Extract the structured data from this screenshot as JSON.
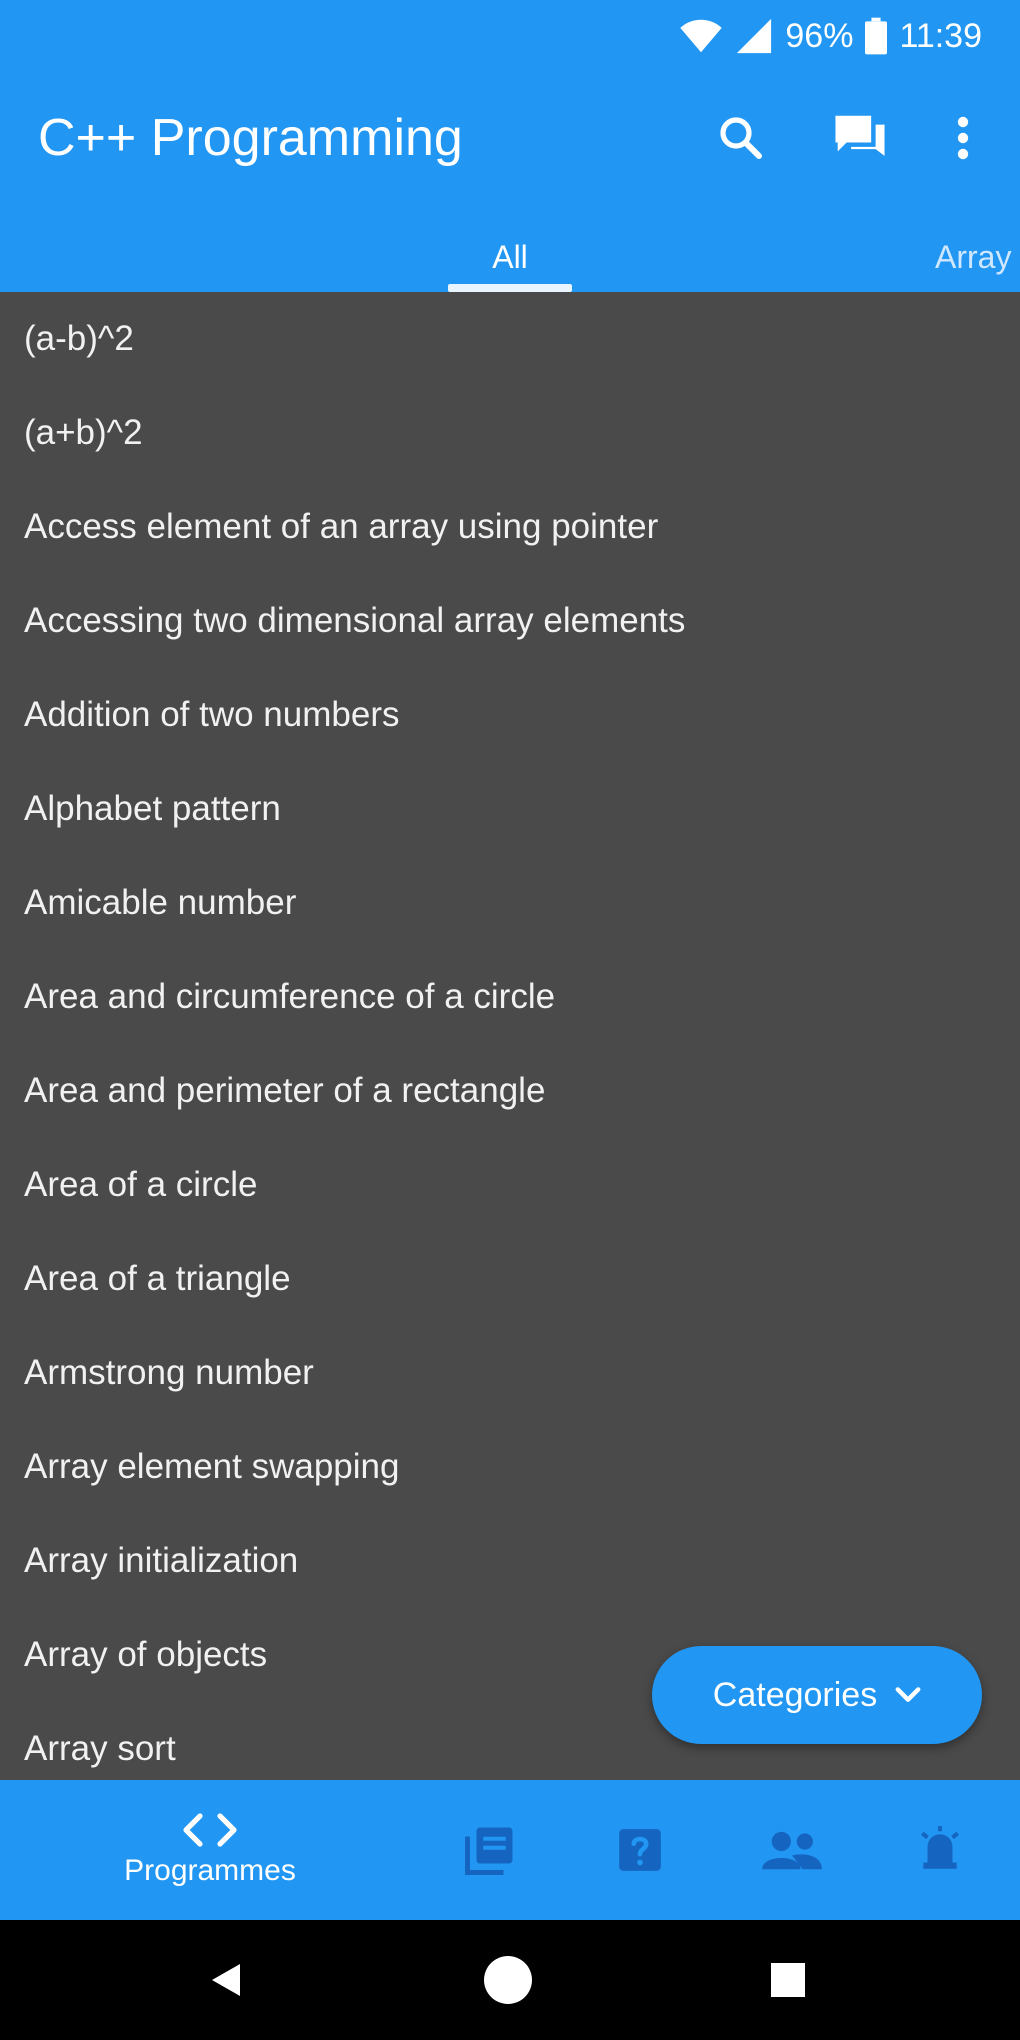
{
  "status_bar": {
    "battery": "96%",
    "time": "11:39"
  },
  "app_bar": {
    "title": "C++ Programming"
  },
  "tabs": [
    {
      "label": "All"
    },
    {
      "label": "Array"
    }
  ],
  "list": {
    "items": [
      "(a-b)^2",
      "(a+b)^2",
      "Access element of an array using pointer",
      "Accessing two dimensional array elements",
      "Addition of two numbers",
      "Alphabet pattern",
      "Amicable number",
      "Area and circumference of a circle",
      "Area and perimeter of a rectangle",
      "Area of a circle",
      "Area of a triangle",
      "Armstrong number",
      "Array element swapping",
      "Array initialization",
      "Array of objects",
      "Array sort"
    ]
  },
  "fab": {
    "label": "Categories"
  },
  "bottom_nav": {
    "active_label": "Programmes"
  },
  "colors": {
    "primary": "#2196F3",
    "list_bg": "#4a4a4a",
    "inactive_icon": "#1565c0"
  }
}
